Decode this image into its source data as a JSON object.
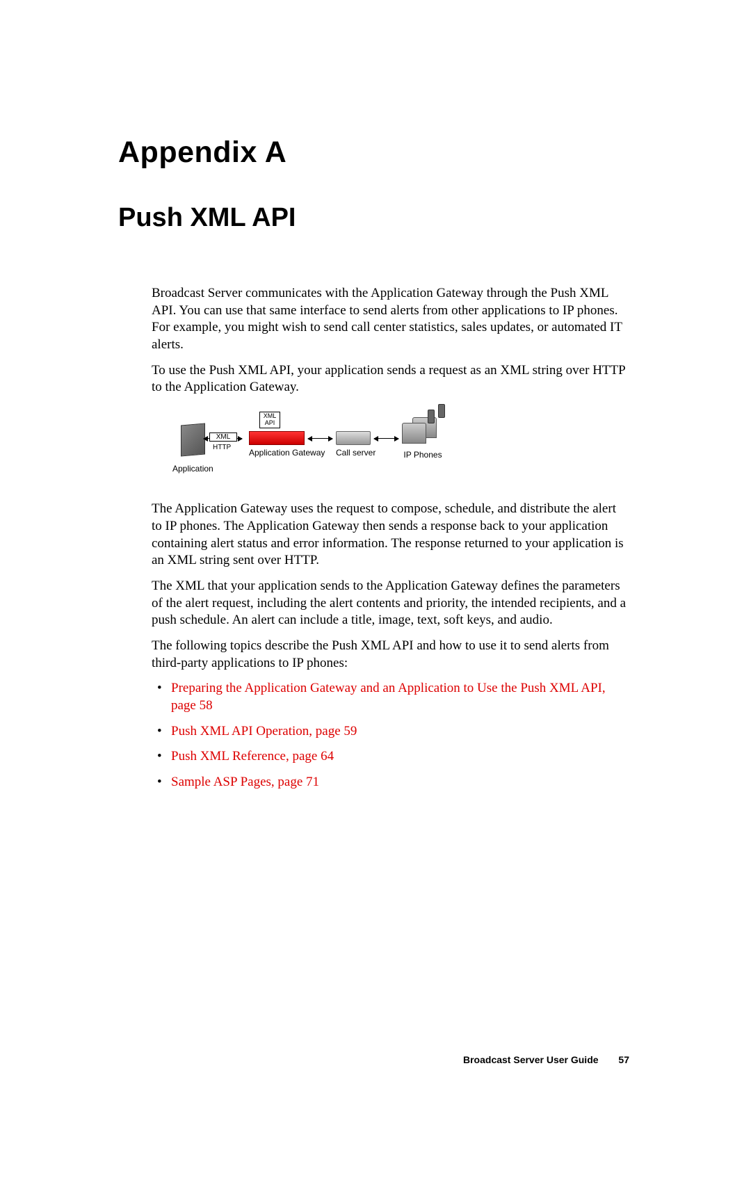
{
  "appendix_label": "Appendix A",
  "chapter_title": "Push XML API",
  "paragraphs": {
    "p1": "Broadcast Server communicates with the Application Gateway through the Push XML API. You can use that same interface to send alerts from other applications to IP phones. For example, you might wish to send call center statistics, sales updates, or automated IT alerts.",
    "p2": "To use the Push XML API, your application sends a request as an XML string over HTTP to the Application Gateway.",
    "p3": "The Application Gateway uses the request to compose, schedule, and distribute the alert to IP phones. The Application Gateway then sends a response back to your application containing alert status and error information. The response returned to your application is an XML string sent over HTTP.",
    "p4": "The XML that your application sends to the Application Gateway defines the parameters of the alert request, including the alert contents and priority, the intended recipients, and a push schedule. An alert can include a title, image, text, soft keys, and audio.",
    "p5": "The following topics describe the Push XML API and how to use it to send alerts from third-party applications to IP phones:"
  },
  "diagram": {
    "application_label": "Application",
    "xml_text": "XML",
    "http_text": "HTTP",
    "xml_api_text": "XML API",
    "gateway_label": "Application Gateway",
    "callserver_label": "Call server",
    "phones_label": "IP Phones"
  },
  "links": {
    "link1": "Preparing the Application Gateway and an Application to Use the Push XML API, page 58",
    "link2": "Push XML API Operation, page 59",
    "link3": "Push XML Reference, page 64",
    "link4": "Sample ASP Pages, page 71"
  },
  "footer": {
    "title": "Broadcast Server User Guide",
    "page": "57"
  }
}
